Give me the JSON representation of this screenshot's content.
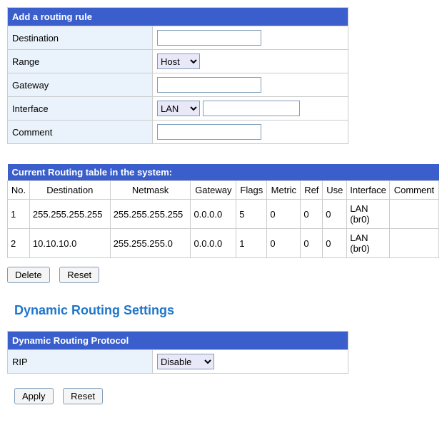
{
  "addRule": {
    "header": "Add a routing rule",
    "destinationLabel": "Destination",
    "destinationValue": "",
    "rangeLabel": "Range",
    "rangeSelected": "Host",
    "gatewayLabel": "Gateway",
    "gatewayValue": "",
    "interfaceLabel": "Interface",
    "interfaceSelected": "LAN",
    "interfaceExtraValue": "",
    "commentLabel": "Comment",
    "commentValue": ""
  },
  "routingTable": {
    "header": "Current Routing table in the system:",
    "columns": {
      "no": "No.",
      "destination": "Destination",
      "netmask": "Netmask",
      "gateway": "Gateway",
      "flags": "Flags",
      "metric": "Metric",
      "ref": "Ref",
      "use": "Use",
      "interface": "Interface",
      "comment": "Comment"
    },
    "rows": [
      {
        "no": "1",
        "destination": "255.255.255.255",
        "netmask": "255.255.255.255",
        "gateway": "0.0.0.0",
        "flags": "5",
        "metric": "0",
        "ref": "0",
        "use": "0",
        "interface": "LAN (br0)",
        "comment": ""
      },
      {
        "no": "2",
        "destination": "10.10.10.0",
        "netmask": "255.255.255.0",
        "gateway": "0.0.0.0",
        "flags": "1",
        "metric": "0",
        "ref": "0",
        "use": "0",
        "interface": "LAN (br0)",
        "comment": ""
      }
    ],
    "deleteLabel": "Delete",
    "resetLabel": "Reset"
  },
  "dynamic": {
    "title": "Dynamic Routing Settings",
    "header": "Dynamic Routing Protocol",
    "ripLabel": "RIP",
    "ripSelected": "Disable",
    "applyLabel": "Apply",
    "resetLabel": "Reset"
  }
}
